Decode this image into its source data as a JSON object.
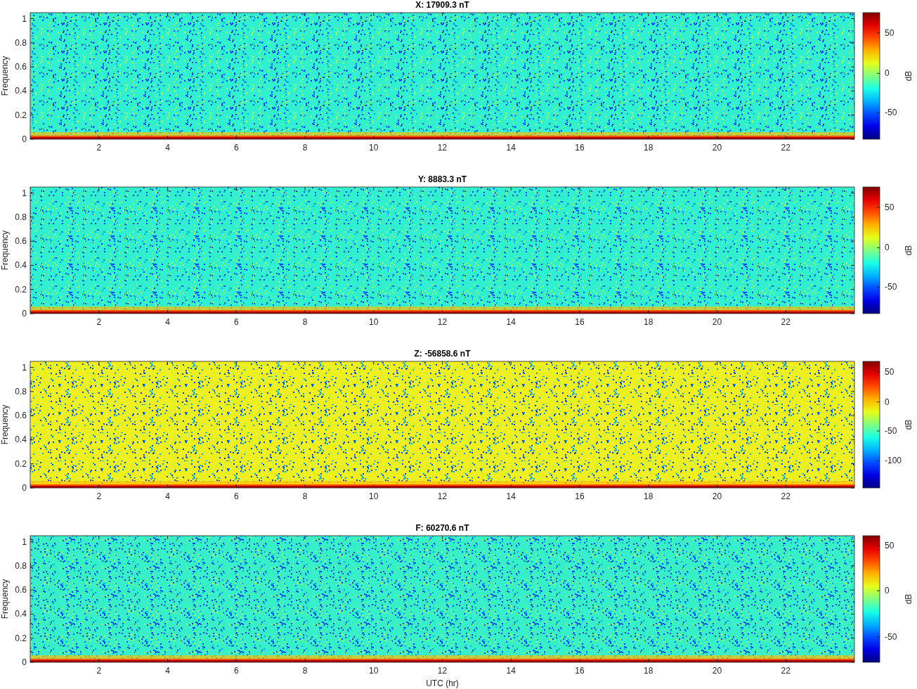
{
  "panels": [
    {
      "title": "X: 17909.3 nT",
      "color": "#30f0d0",
      "ylabel": "Frequency",
      "xticks": [
        "2",
        "4",
        "6",
        "8",
        "10",
        "12",
        "14",
        "16",
        "18",
        "20",
        "22"
      ],
      "yticks": [
        "1",
        "0.8",
        "0.6",
        "0.4",
        "0.2",
        "0"
      ],
      "colorbar": {
        "label": "dB",
        "ticks": [
          {
            "label": "50",
            "level": 0.84
          },
          {
            "label": "0",
            "level": 0.52
          },
          {
            "label": "-50",
            "level": 0.21
          }
        ]
      }
    },
    {
      "title": "Y: 8883.3 nT",
      "color": "#30f0d0",
      "ylabel": "Frequency",
      "xticks": [
        "2",
        "4",
        "6",
        "8",
        "10",
        "12",
        "14",
        "16",
        "18",
        "20",
        "22"
      ],
      "yticks": [
        "1",
        "0.8",
        "0.6",
        "0.4",
        "0.2",
        "0"
      ],
      "colorbar": {
        "label": "dB",
        "ticks": [
          {
            "label": "50",
            "level": 0.84
          },
          {
            "label": "0",
            "level": 0.52
          },
          {
            "label": "-50",
            "level": 0.21
          }
        ]
      }
    },
    {
      "title": "Z: -56858.6 nT",
      "color": "#f0f020",
      "ylabel": "Frequency",
      "xticks": [
        "2",
        "4",
        "6",
        "8",
        "10",
        "12",
        "14",
        "16",
        "18",
        "20",
        "22"
      ],
      "yticks": [
        "1",
        "0.8",
        "0.6",
        "0.4",
        "0.2",
        "0"
      ],
      "colorbar": {
        "label": "dB",
        "ticks": [
          {
            "label": "50",
            "level": 0.915
          },
          {
            "label": "0",
            "level": 0.68
          },
          {
            "label": "-50",
            "level": 0.45
          },
          {
            "label": "-100",
            "level": 0.215
          }
        ]
      }
    },
    {
      "title": "F: 60270.6 nT",
      "color": "#38f0c8",
      "ylabel": "Frequency",
      "xlabel": "UTC (hr)",
      "xticks": [
        "2",
        "4",
        "6",
        "8",
        "10",
        "12",
        "14",
        "16",
        "18",
        "20",
        "22"
      ],
      "yticks": [
        "1",
        "0.8",
        "0.6",
        "0.4",
        "0.2",
        "0"
      ],
      "colorbar": {
        "label": "dB",
        "ticks": [
          {
            "label": "50",
            "level": 0.92
          },
          {
            "label": "0",
            "level": 0.565
          },
          {
            "label": "-50",
            "level": 0.2
          }
        ]
      }
    }
  ]
}
